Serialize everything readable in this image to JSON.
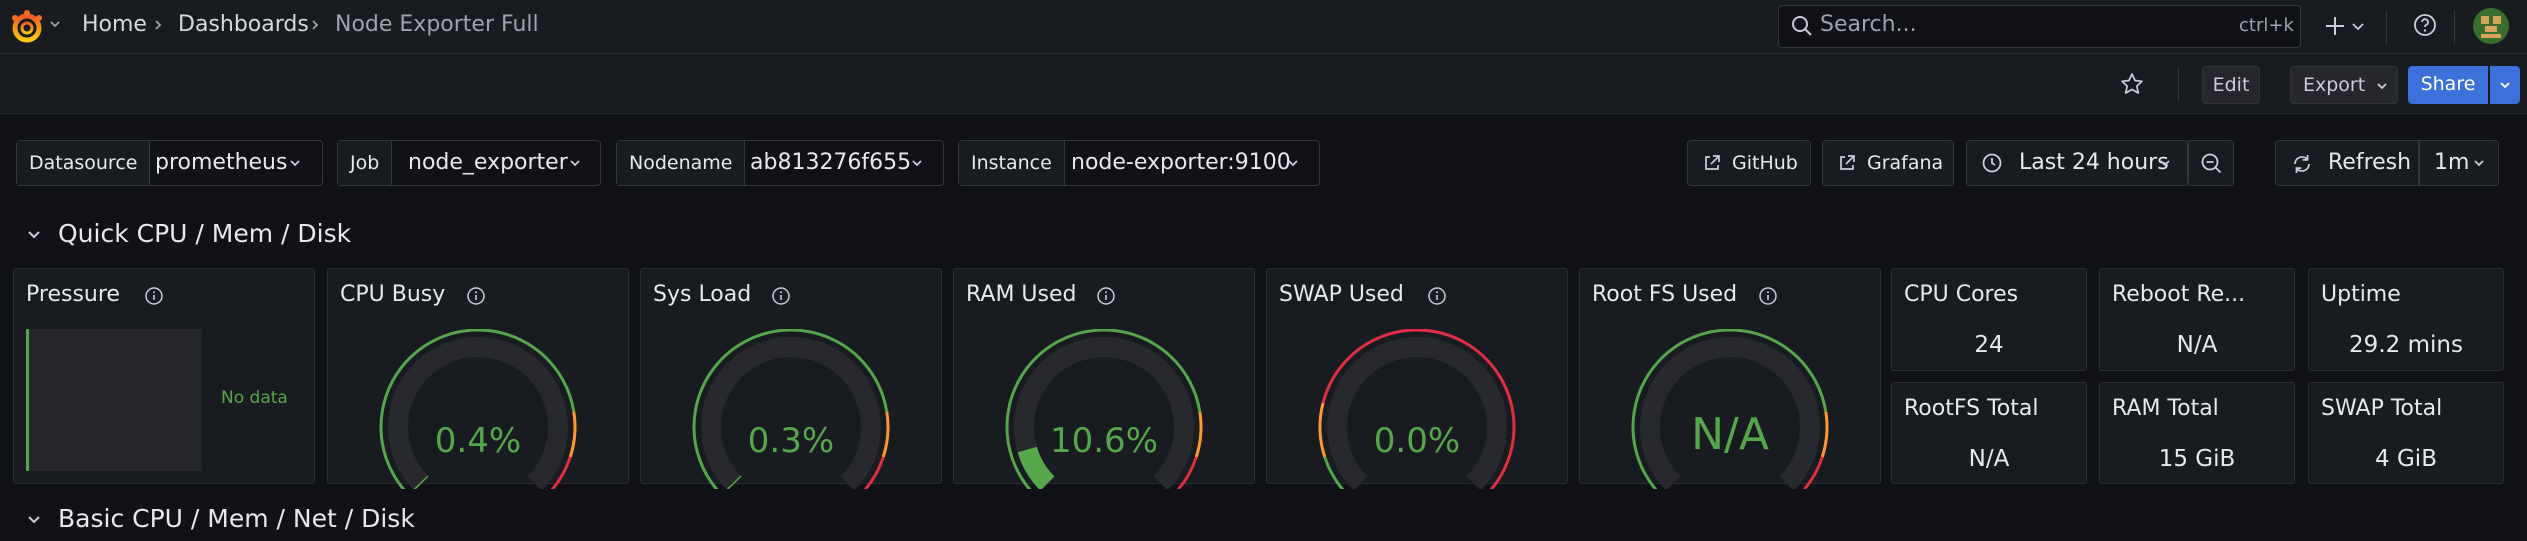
{
  "colors": {
    "accent_blue": "#3d71d9",
    "green": "#56a64b",
    "orange": "#ff9830",
    "red": "#e02f44",
    "panel_bg": "#181b1f",
    "page_bg": "#111217"
  },
  "breadcrumbs": [
    "Home",
    "Dashboards",
    "Node Exporter Full"
  ],
  "search": {
    "placeholder": "Search...",
    "shortcut": "ctrl+k"
  },
  "topbar_icons": [
    "plus-icon",
    "help-icon",
    "user-avatar"
  ],
  "actions": {
    "edit": "Edit",
    "export": "Export",
    "share": "Share"
  },
  "variables": [
    {
      "label": "Datasource",
      "value": "prometheus"
    },
    {
      "label": "Job",
      "value": "node_exporter"
    },
    {
      "label": "Nodename",
      "value": "ab813276f655"
    },
    {
      "label": "Instance",
      "value": "node-exporter:9100"
    }
  ],
  "links": {
    "github": "GitHub",
    "grafana": "Grafana"
  },
  "time": {
    "range": "Last 24 hours",
    "refresh": "Refresh",
    "interval": "1m"
  },
  "rows": {
    "quick": "Quick CPU / Mem / Disk",
    "basic": "Basic CPU / Mem / Net / Disk"
  },
  "panels": {
    "pressure": {
      "title": "Pressure",
      "no_data": "No data"
    },
    "gauges": [
      {
        "title": "CPU Busy",
        "value": "0.4%",
        "percent": 0.4,
        "color": "#56a64b"
      },
      {
        "title": "Sys Load",
        "value": "0.3%",
        "percent": 0.3,
        "color": "#56a64b"
      },
      {
        "title": "RAM Used",
        "value": "10.6%",
        "percent": 10.6,
        "color": "#56a64b"
      },
      {
        "title": "SWAP Used",
        "value": "0.0%",
        "percent": 0.0,
        "color": "#56a64b"
      },
      {
        "title": "Root FS Used",
        "value": "N/A",
        "percent": null,
        "color": "#56a64b"
      }
    ],
    "stats": [
      {
        "title": "CPU Cores",
        "value": "24"
      },
      {
        "title": "Reboot Re...",
        "value": "N/A"
      },
      {
        "title": "Uptime",
        "value": "29.2 mins"
      },
      {
        "title": "RootFS Total",
        "value": "N/A"
      },
      {
        "title": "RAM Total",
        "value": "15 GiB"
      },
      {
        "title": "SWAP Total",
        "value": "4 GiB"
      }
    ]
  }
}
